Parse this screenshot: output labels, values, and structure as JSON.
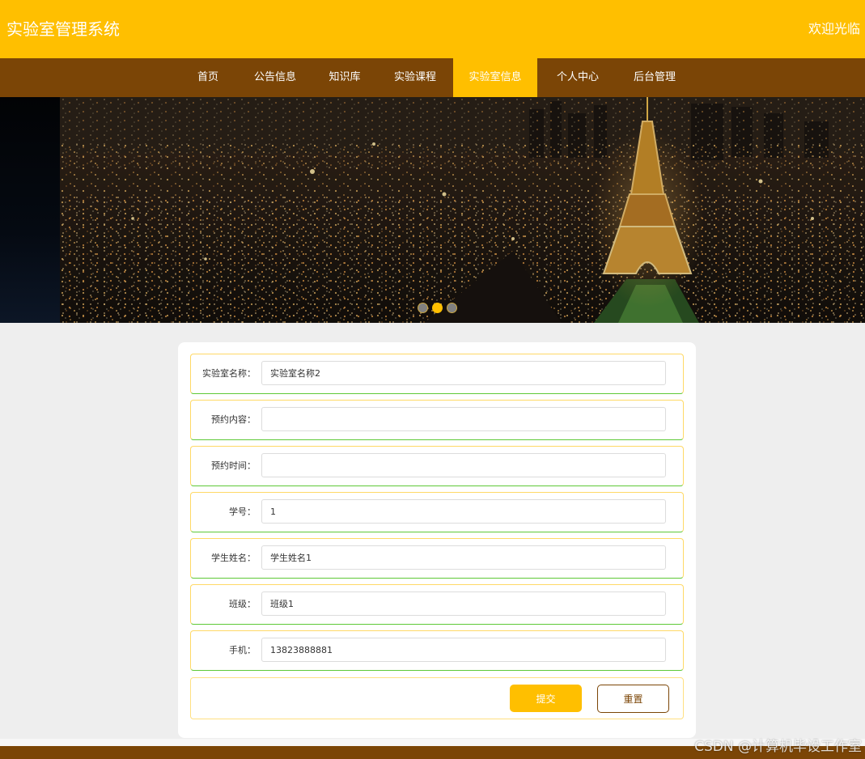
{
  "header": {
    "site_title": "实验室管理系统",
    "welcome": "欢迎光临"
  },
  "nav": {
    "items": [
      {
        "label": "首页"
      },
      {
        "label": "公告信息"
      },
      {
        "label": "知识库"
      },
      {
        "label": "实验课程"
      },
      {
        "label": "实验室信息",
        "active": true
      },
      {
        "label": "个人中心"
      },
      {
        "label": "后台管理"
      }
    ]
  },
  "banner": {
    "slides_total": 3,
    "active_slide": 2
  },
  "form": {
    "fields": [
      {
        "label": "实验室名称：",
        "value": "实验室名称2"
      },
      {
        "label": "预约内容：",
        "value": ""
      },
      {
        "label": "预约时间：",
        "value": ""
      },
      {
        "label": "学号：",
        "value": "1"
      },
      {
        "label": "学生姓名：",
        "value": "学生姓名1"
      },
      {
        "label": "班级：",
        "value": "班级1"
      },
      {
        "label": "手机：",
        "value": "13823888881"
      }
    ],
    "submit_label": "提交",
    "reset_label": "重置"
  },
  "watermark": "CSDN @计算机毕设工作室",
  "colors": {
    "primary": "#ffbf00",
    "nav_bg": "#7b4506",
    "page_bg": "#eeeeee"
  }
}
